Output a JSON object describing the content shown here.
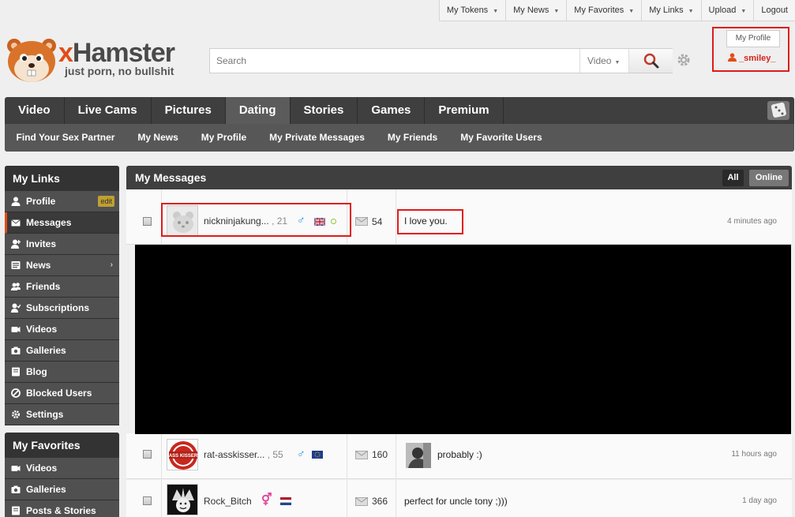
{
  "topbar": {
    "items": [
      {
        "label": "My Tokens",
        "caret": true
      },
      {
        "label": "My News",
        "caret": true
      },
      {
        "label": "My Favorites",
        "caret": true
      },
      {
        "label": "My Links",
        "caret": true
      },
      {
        "label": "Upload",
        "caret": true
      },
      {
        "label": "Logout",
        "caret": false
      }
    ]
  },
  "logo": {
    "brand_x": "x",
    "brand_rest": "Hamster",
    "tagline": "just porn, no bullshit"
  },
  "search": {
    "placeholder": "Search",
    "category": "Video",
    "button_icon": "magnifier-icon",
    "settings_icon": "gear-icon"
  },
  "profile": {
    "button_label": "My Profile",
    "username": "_smiley_",
    "user_icon": "user-icon"
  },
  "nav": {
    "main": [
      {
        "label": "Video",
        "active": false
      },
      {
        "label": "Live Cams",
        "active": false
      },
      {
        "label": "Pictures",
        "active": false
      },
      {
        "label": "Dating",
        "active": true
      },
      {
        "label": "Stories",
        "active": false
      },
      {
        "label": "Games",
        "active": false
      },
      {
        "label": "Premium",
        "active": false
      }
    ],
    "sub": [
      {
        "label": "Find Your Sex Partner"
      },
      {
        "label": "My News"
      },
      {
        "label": "My Profile"
      },
      {
        "label": "My Private Messages"
      },
      {
        "label": "My Friends"
      },
      {
        "label": "My Favorite Users"
      }
    ],
    "random_icon": "dice-icon"
  },
  "sidebar": {
    "links_title": "My Links",
    "links": [
      {
        "label": "Profile",
        "icon": "user-icon",
        "badge": "edit"
      },
      {
        "label": "Messages",
        "icon": "envelope-icon",
        "active": true
      },
      {
        "label": "Invites",
        "icon": "user-add-icon"
      },
      {
        "label": "News",
        "icon": "news-icon",
        "arrow": "›"
      },
      {
        "label": "Friends",
        "icon": "users-icon"
      },
      {
        "label": "Subscriptions",
        "icon": "subscription-icon"
      },
      {
        "label": "Videos",
        "icon": "video-camera-icon"
      },
      {
        "label": "Galleries",
        "icon": "camera-icon"
      },
      {
        "label": "Blog",
        "icon": "blog-icon"
      },
      {
        "label": "Blocked Users",
        "icon": "blocked-icon"
      },
      {
        "label": "Settings",
        "icon": "gear-icon"
      }
    ],
    "favorites_title": "My Favorites",
    "favorites": [
      {
        "label": "Videos",
        "icon": "video-camera-icon"
      },
      {
        "label": "Galleries",
        "icon": "camera-icon"
      },
      {
        "label": "Posts & Stories",
        "icon": "blog-icon"
      }
    ]
  },
  "messages": {
    "title": "My Messages",
    "tab_all": "All",
    "tab_online": "Online",
    "rows": [
      {
        "username": "nickninjakung...",
        "age": ", 21",
        "gender": "♂",
        "count": "54",
        "text": "I love you.",
        "time": "4 minutes ago"
      },
      {
        "username": "rat-asskisser...",
        "age": ", 55",
        "gender": "♂",
        "count": "160",
        "text": "probably :)",
        "time": "11 hours ago",
        "avatar_text": "ASS KISSER"
      },
      {
        "username": "Rock_Bitch",
        "age": "",
        "gender": "⚥",
        "count": "366",
        "text": "perfect for uncle tony ;)))",
        "time": "1 day ago"
      }
    ]
  },
  "colors": {
    "accent": "#e24c19",
    "highlight": "#e01b1b",
    "male": "#1e8de0",
    "female": "#e0459a",
    "nav_bg": "#3f3f3f"
  }
}
